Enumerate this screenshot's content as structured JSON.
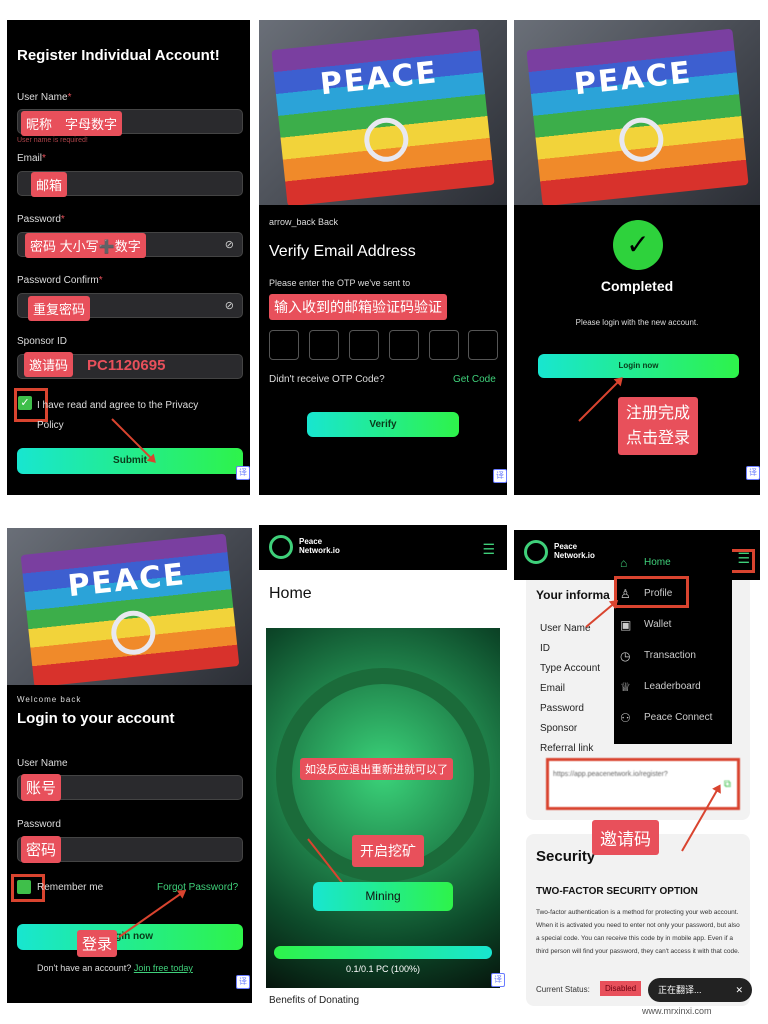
{
  "register": {
    "title": "Register Individual Account!",
    "username_label": "User Name",
    "required_mark": "*",
    "username_ann": "昵称　字母数字",
    "username_error": "User name is required!",
    "email_label": "Email",
    "email_ann": "邮箱",
    "password_label": "Password",
    "password_ann": "密码 大小写➕数字",
    "confirm_label": "Password Confirm",
    "confirm_ann": "重复密码",
    "sponsor_label": "Sponsor ID",
    "sponsor_ann": "邀请码",
    "sponsor_code": "PC1120695",
    "agree_text": "I have read and agree to the Privacy Policy",
    "submit": "Submit",
    "translate_icon": "译"
  },
  "verify": {
    "flag_text": "PEACE",
    "back": "arrow_back  Back",
    "title": "Verify Email Address",
    "instruction": "Please enter the OTP we've sent to",
    "ann": "输入收到的邮箱验证码验证",
    "resend_prompt": "Didn't receive OTP Code?",
    "get_code": "Get Code",
    "verify_btn": "Verify",
    "translate_icon": "译"
  },
  "completed": {
    "flag_text": "PEACE",
    "title": "Completed",
    "message": "Please login with the new account.",
    "login_btn": "Login now",
    "ann": "注册完成\n点击登录",
    "translate_icon": "译"
  },
  "login": {
    "flag_text": "PEACE",
    "welcome": "Welcome back",
    "title": "Login to your account",
    "username_label": "User Name",
    "username_ann": "账号",
    "password_label": "Password",
    "password_ann": "密码",
    "remember": "Remember me",
    "forgot": "Forgot Password?",
    "login_btn": "Login now",
    "login_ann": "登录",
    "no_account": "Don't have an account?",
    "join": "Join free today",
    "translate_icon": "译"
  },
  "home": {
    "logo_line1": "Peace",
    "logo_line2": "Network.io",
    "title": "Home",
    "ann_retry": "如没反应退出重新进就可以了",
    "ann_mining": "开启挖矿",
    "mining_btn": "Mining",
    "progress_text": "0.1/0.1 PC (100%)",
    "progress_percent": 100,
    "below_text": "Benefits of Donating",
    "translate_icon": "译"
  },
  "profile": {
    "logo_line1": "Peace",
    "logo_line2": "Network.io",
    "menu": [
      {
        "label": "Home",
        "icon": "home-icon",
        "glyph": "⌂"
      },
      {
        "label": "Profile",
        "icon": "user-icon",
        "glyph": "♙"
      },
      {
        "label": "Wallet",
        "icon": "wallet-icon",
        "glyph": "▣"
      },
      {
        "label": "Transaction",
        "icon": "clock-icon",
        "glyph": "◷"
      },
      {
        "label": "Leaderboard",
        "icon": "trophy-icon",
        "glyph": "♕"
      },
      {
        "label": "Peace Connect",
        "icon": "people-icon",
        "glyph": "⚇"
      }
    ],
    "info_title": "Your informa",
    "info_rows": [
      "User Name",
      "ID",
      "Type Account",
      "Email",
      "Password",
      "Sponsor",
      "Referral link"
    ],
    "referral_value": "https://app.peacenetwork.io/register?",
    "ann": "邀请码",
    "security_title": "Security",
    "twofa_title": "TWO-FACTOR SECURITY OPTION",
    "twofa_text": "Two-factor authentication is a method for protecting your web account. When it is activated you need to enter not only your password, but also a special code. You can receive this code by in mobile app. Even if a third person will find your password, they can't access it with that code.",
    "status_label": "Current Status:",
    "status_value": "Disabled",
    "translating": "正在翻译...",
    "watermark": "www.mrxinxi.com"
  },
  "colors": {
    "accent_start": "#18e6d0",
    "accent_end": "#2ef34a",
    "annotation": "#e8505b",
    "highlight": "#d9442f"
  }
}
